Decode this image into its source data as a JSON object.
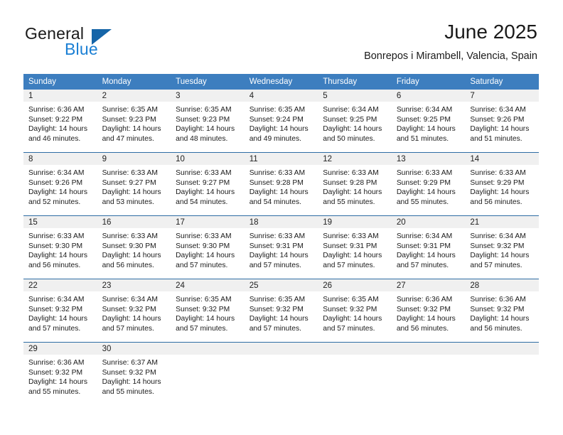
{
  "branding": {
    "name_part1": "General",
    "name_part2": "Blue",
    "accent_color": "#1a7fd4",
    "triangle_color": "#1565a8"
  },
  "header": {
    "month_title": "June 2025",
    "location": "Bonrepos i Mirambell, Valencia, Spain",
    "header_bg": "#3d7ebf",
    "row_divider": "#2e6da4",
    "daynum_bg": "#f0f0f0"
  },
  "weekday_headers": [
    "Sunday",
    "Monday",
    "Tuesday",
    "Wednesday",
    "Thursday",
    "Friday",
    "Saturday"
  ],
  "weeks": [
    [
      {
        "day": "1",
        "sunrise": "Sunrise: 6:36 AM",
        "sunset": "Sunset: 9:22 PM",
        "daylight": "Daylight: 14 hours and 46 minutes."
      },
      {
        "day": "2",
        "sunrise": "Sunrise: 6:35 AM",
        "sunset": "Sunset: 9:23 PM",
        "daylight": "Daylight: 14 hours and 47 minutes."
      },
      {
        "day": "3",
        "sunrise": "Sunrise: 6:35 AM",
        "sunset": "Sunset: 9:23 PM",
        "daylight": "Daylight: 14 hours and 48 minutes."
      },
      {
        "day": "4",
        "sunrise": "Sunrise: 6:35 AM",
        "sunset": "Sunset: 9:24 PM",
        "daylight": "Daylight: 14 hours and 49 minutes."
      },
      {
        "day": "5",
        "sunrise": "Sunrise: 6:34 AM",
        "sunset": "Sunset: 9:25 PM",
        "daylight": "Daylight: 14 hours and 50 minutes."
      },
      {
        "day": "6",
        "sunrise": "Sunrise: 6:34 AM",
        "sunset": "Sunset: 9:25 PM",
        "daylight": "Daylight: 14 hours and 51 minutes."
      },
      {
        "day": "7",
        "sunrise": "Sunrise: 6:34 AM",
        "sunset": "Sunset: 9:26 PM",
        "daylight": "Daylight: 14 hours and 51 minutes."
      }
    ],
    [
      {
        "day": "8",
        "sunrise": "Sunrise: 6:34 AM",
        "sunset": "Sunset: 9:26 PM",
        "daylight": "Daylight: 14 hours and 52 minutes."
      },
      {
        "day": "9",
        "sunrise": "Sunrise: 6:33 AM",
        "sunset": "Sunset: 9:27 PM",
        "daylight": "Daylight: 14 hours and 53 minutes."
      },
      {
        "day": "10",
        "sunrise": "Sunrise: 6:33 AM",
        "sunset": "Sunset: 9:27 PM",
        "daylight": "Daylight: 14 hours and 54 minutes."
      },
      {
        "day": "11",
        "sunrise": "Sunrise: 6:33 AM",
        "sunset": "Sunset: 9:28 PM",
        "daylight": "Daylight: 14 hours and 54 minutes."
      },
      {
        "day": "12",
        "sunrise": "Sunrise: 6:33 AM",
        "sunset": "Sunset: 9:28 PM",
        "daylight": "Daylight: 14 hours and 55 minutes."
      },
      {
        "day": "13",
        "sunrise": "Sunrise: 6:33 AM",
        "sunset": "Sunset: 9:29 PM",
        "daylight": "Daylight: 14 hours and 55 minutes."
      },
      {
        "day": "14",
        "sunrise": "Sunrise: 6:33 AM",
        "sunset": "Sunset: 9:29 PM",
        "daylight": "Daylight: 14 hours and 56 minutes."
      }
    ],
    [
      {
        "day": "15",
        "sunrise": "Sunrise: 6:33 AM",
        "sunset": "Sunset: 9:30 PM",
        "daylight": "Daylight: 14 hours and 56 minutes."
      },
      {
        "day": "16",
        "sunrise": "Sunrise: 6:33 AM",
        "sunset": "Sunset: 9:30 PM",
        "daylight": "Daylight: 14 hours and 56 minutes."
      },
      {
        "day": "17",
        "sunrise": "Sunrise: 6:33 AM",
        "sunset": "Sunset: 9:30 PM",
        "daylight": "Daylight: 14 hours and 57 minutes."
      },
      {
        "day": "18",
        "sunrise": "Sunrise: 6:33 AM",
        "sunset": "Sunset: 9:31 PM",
        "daylight": "Daylight: 14 hours and 57 minutes."
      },
      {
        "day": "19",
        "sunrise": "Sunrise: 6:33 AM",
        "sunset": "Sunset: 9:31 PM",
        "daylight": "Daylight: 14 hours and 57 minutes."
      },
      {
        "day": "20",
        "sunrise": "Sunrise: 6:34 AM",
        "sunset": "Sunset: 9:31 PM",
        "daylight": "Daylight: 14 hours and 57 minutes."
      },
      {
        "day": "21",
        "sunrise": "Sunrise: 6:34 AM",
        "sunset": "Sunset: 9:32 PM",
        "daylight": "Daylight: 14 hours and 57 minutes."
      }
    ],
    [
      {
        "day": "22",
        "sunrise": "Sunrise: 6:34 AM",
        "sunset": "Sunset: 9:32 PM",
        "daylight": "Daylight: 14 hours and 57 minutes."
      },
      {
        "day": "23",
        "sunrise": "Sunrise: 6:34 AM",
        "sunset": "Sunset: 9:32 PM",
        "daylight": "Daylight: 14 hours and 57 minutes."
      },
      {
        "day": "24",
        "sunrise": "Sunrise: 6:35 AM",
        "sunset": "Sunset: 9:32 PM",
        "daylight": "Daylight: 14 hours and 57 minutes."
      },
      {
        "day": "25",
        "sunrise": "Sunrise: 6:35 AM",
        "sunset": "Sunset: 9:32 PM",
        "daylight": "Daylight: 14 hours and 57 minutes."
      },
      {
        "day": "26",
        "sunrise": "Sunrise: 6:35 AM",
        "sunset": "Sunset: 9:32 PM",
        "daylight": "Daylight: 14 hours and 57 minutes."
      },
      {
        "day": "27",
        "sunrise": "Sunrise: 6:36 AM",
        "sunset": "Sunset: 9:32 PM",
        "daylight": "Daylight: 14 hours and 56 minutes."
      },
      {
        "day": "28",
        "sunrise": "Sunrise: 6:36 AM",
        "sunset": "Sunset: 9:32 PM",
        "daylight": "Daylight: 14 hours and 56 minutes."
      }
    ],
    [
      {
        "day": "29",
        "sunrise": "Sunrise: 6:36 AM",
        "sunset": "Sunset: 9:32 PM",
        "daylight": "Daylight: 14 hours and 55 minutes."
      },
      {
        "day": "30",
        "sunrise": "Sunrise: 6:37 AM",
        "sunset": "Sunset: 9:32 PM",
        "daylight": "Daylight: 14 hours and 55 minutes."
      },
      {
        "day": "",
        "sunrise": "",
        "sunset": "",
        "daylight": ""
      },
      {
        "day": "",
        "sunrise": "",
        "sunset": "",
        "daylight": ""
      },
      {
        "day": "",
        "sunrise": "",
        "sunset": "",
        "daylight": ""
      },
      {
        "day": "",
        "sunrise": "",
        "sunset": "",
        "daylight": ""
      },
      {
        "day": "",
        "sunrise": "",
        "sunset": "",
        "daylight": ""
      }
    ]
  ]
}
